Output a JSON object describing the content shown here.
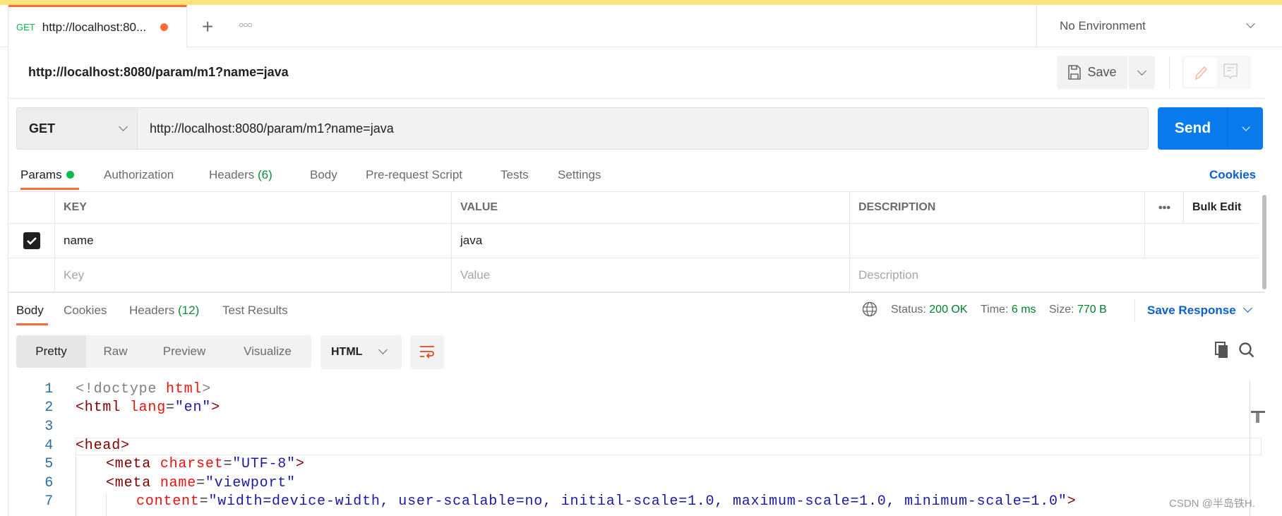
{
  "tab": {
    "method": "GET",
    "title": "http://localhost:80...",
    "unsaved_color": "#FF6C37"
  },
  "environment": "No Environment",
  "request_title": "http://localhost:8080/param/m1?name=java",
  "save_label": "Save",
  "method": "GET",
  "url": "http://localhost:8080/param/m1?name=java",
  "send_label": "Send",
  "request_tabs": [
    {
      "label": "Params"
    },
    {
      "label": "Authorization"
    },
    {
      "label": "Headers",
      "count": "(6)"
    },
    {
      "label": "Body"
    },
    {
      "label": "Pre-request Script"
    },
    {
      "label": "Tests"
    },
    {
      "label": "Settings"
    }
  ],
  "cookies_link": "Cookies",
  "params_table": {
    "headers": [
      "KEY",
      "VALUE",
      "DESCRIPTION",
      "Bulk Edit"
    ],
    "rows": [
      {
        "checked": true,
        "key": "name",
        "value": "java",
        "description": ""
      }
    ],
    "placeholders": {
      "key": "Key",
      "value": "Value",
      "description": "Description"
    }
  },
  "response_tabs": [
    {
      "label": "Body"
    },
    {
      "label": "Cookies"
    },
    {
      "label": "Headers",
      "count": "(12)"
    },
    {
      "label": "Test Results"
    }
  ],
  "status": {
    "status_label": "Status:",
    "status": "200 OK",
    "time_label": "Time:",
    "time": "6 ms",
    "size_label": "Size:",
    "size": "770 B"
  },
  "save_response": "Save Response",
  "view_modes": [
    "Pretty",
    "Raw",
    "Preview",
    "Visualize"
  ],
  "active_view": "Pretty",
  "format": "HTML",
  "code_lines": [
    "1",
    "2",
    "3",
    "4",
    "5",
    "6",
    "7"
  ],
  "code": {
    "l1a": "<!doctype ",
    "l1b": "html",
    "l1c": ">",
    "l2a": "<html ",
    "l2b": "lang",
    "l2c": "=",
    "l2d": "\"en\"",
    "l2e": ">",
    "l4": "<head>",
    "l5a": "<meta ",
    "l5b": "charset",
    "l5c": "=",
    "l5d": "\"UTF-8\"",
    "l5e": ">",
    "l6a": "<meta ",
    "l6b": "name",
    "l6c": "=",
    "l6d": "\"viewport\"",
    "l7a": "content",
    "l7b": "=",
    "l7c": "\"width=device-width, user-scalable=no, initial-scale=1.0, maximum-scale=1.0, minimum-scale=1.0\"",
    "l7d": ">"
  },
  "watermark": "CSDN @半岛铁H.",
  "colors": {
    "accent": "#FF6C37",
    "primary": "#097BED",
    "success": "#0CBB52",
    "status_green": "#007F31"
  }
}
